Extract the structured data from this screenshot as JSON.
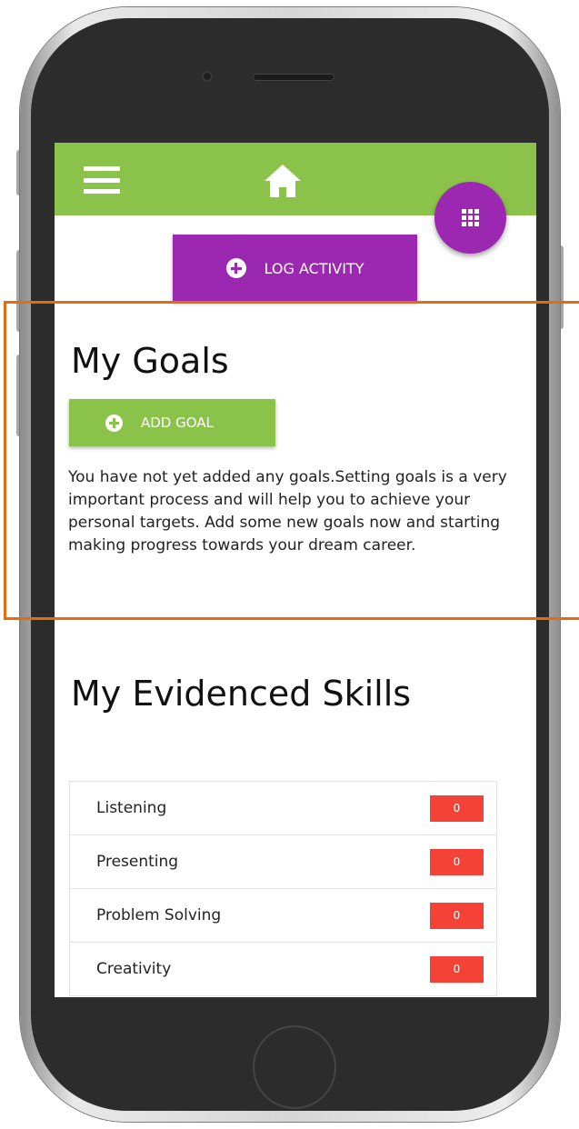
{
  "header": {
    "menu_icon": "hamburger-menu-icon",
    "home_icon": "home-icon",
    "apps_icon": "grid-icon",
    "accent_color": "#8bc34a",
    "primary_color": "#9c27b0"
  },
  "log_activity": {
    "label": "LOG ACTIVITY",
    "icon": "plus-circle-icon"
  },
  "goals": {
    "title": "My Goals",
    "add_label": "ADD GOAL",
    "empty_text": "You have not yet added any goals.Setting goals is a very important process and will help you to achieve your personal targets. Add some new goals now and starting making progress towards your dream career."
  },
  "skills": {
    "title": "My Evidenced Skills",
    "badge_color": "#f44336",
    "items": [
      {
        "label": "Listening",
        "count": "0"
      },
      {
        "label": "Presenting",
        "count": "0"
      },
      {
        "label": "Problem Solving",
        "count": "0"
      },
      {
        "label": "Creativity",
        "count": "0"
      }
    ]
  },
  "highlight_color": "#e46c0a"
}
